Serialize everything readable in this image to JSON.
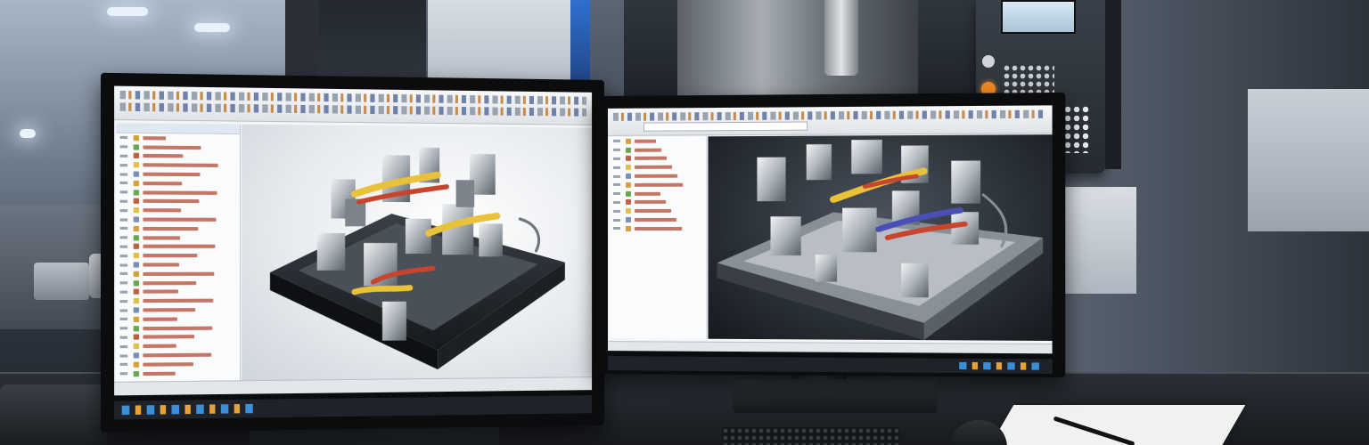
{
  "scene": {
    "description_colors": {
      "accent_yellow": "#e9c23a",
      "accent_red": "#c8452d",
      "accent_blue": "#4a4fb5",
      "machine_orange": "#f08a24"
    }
  },
  "monitor_left": {
    "viewport_theme": "light",
    "icons": [
      "toolbar-icons",
      "feature-tree",
      "3d-fixture-model",
      "taskbar"
    ]
  },
  "monitor_right": {
    "viewport_theme": "dark",
    "icons": [
      "toolbar-icons",
      "feature-tree",
      "3d-fixture-model",
      "taskbar"
    ]
  }
}
